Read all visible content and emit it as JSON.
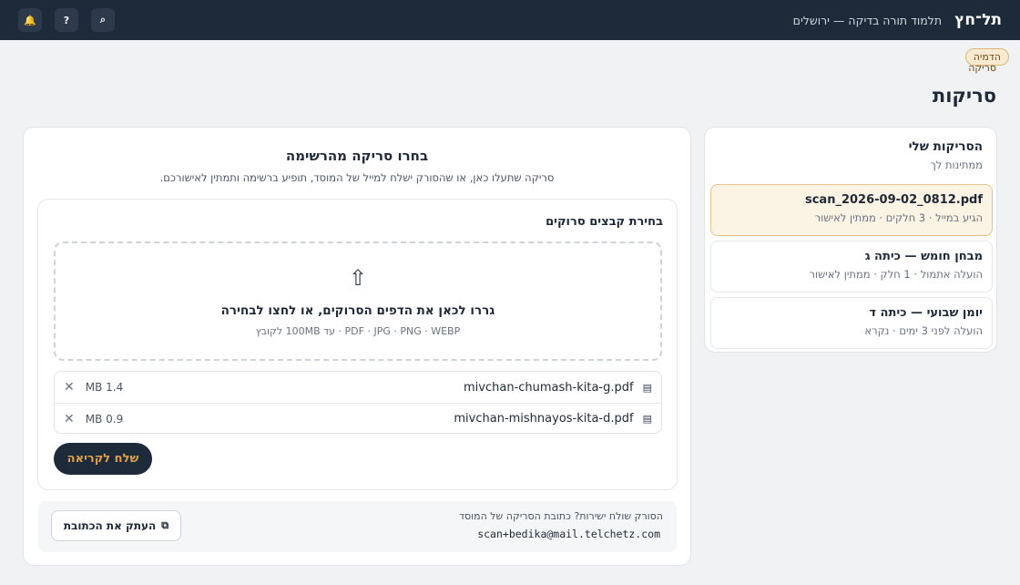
{
  "header": {
    "logo": "תל־חץ",
    "school": "תלמוד תורה בדיקה — ירושלים",
    "buttons": [
      {
        "name": "notifications",
        "glyph": "🔔"
      },
      {
        "name": "help",
        "glyph": "?"
      },
      {
        "name": "search",
        "glyph": "⌕"
      }
    ]
  },
  "demo": {
    "badge": "הדמיה",
    "sub": "סריקה"
  },
  "page_title": "סריקות",
  "scans_panel": {
    "title": "הסריקות שלי",
    "subtitle": "ממתינות לך",
    "items": [
      {
        "name": "scan_2026-09-02_0812.pdf",
        "meta": "הגיע במייל · 3 חלקים · ממתין לאישור",
        "active": true
      },
      {
        "name": "מבחן חומש — כיתה ג",
        "meta": "הועלה אתמול · 1 חלק · ממתין לאישור",
        "active": false
      },
      {
        "name": "יומן שבועי — כיתה ד",
        "meta": "הועלה לפני 3 ימים · נקרא",
        "active": false
      }
    ]
  },
  "main": {
    "title": "בחרו סריקה מהרשימה",
    "subtitle": "סריקה שתעלו כאן, או שהסורק ישלח למייל של המוסד, תופיע ברשימה ותמתין לאישורכם.",
    "upload": {
      "label": "בחירת קבצים סרוקים",
      "drop_icon": "⇧",
      "drop_text": "גררו לכאן את הדפים הסרוקים, או לחצו לבחירה",
      "drop_hint": "PDF · JPG · PNG · WEBP · עד 100MB לקובץ",
      "files": [
        {
          "name": "mivchan-chumash-kita-g.pdf",
          "size": "1.4 MB"
        },
        {
          "name": "mivchan-mishnayos-kita-d.pdf",
          "size": "0.9 MB"
        }
      ],
      "send_label": "שלח לקריאה"
    },
    "forward": {
      "text": "הסורק שולח ישירות? כתובת הסריקה של המוסד",
      "email": "scan+bedika@mail.telchetz.com",
      "copy_label": "העתק את הכתובת"
    }
  },
  "colors": {
    "topbar": "#1d2a3a",
    "accent": "#e0a04a",
    "active_item_bg": "#fbf3e4"
  }
}
